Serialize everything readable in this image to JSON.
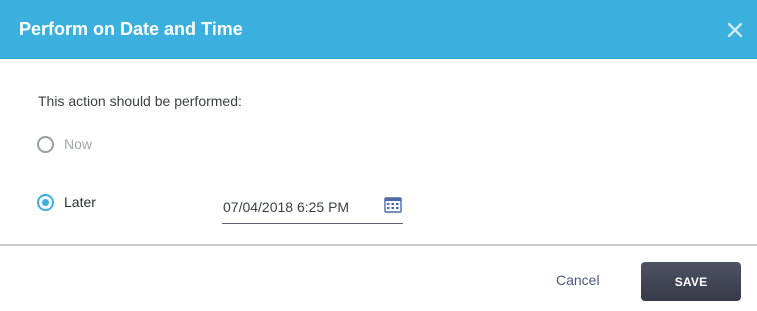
{
  "dialog": {
    "title": "Perform on Date and Time",
    "close_icon": "close-icon"
  },
  "form": {
    "prompt": "This action should be performed:",
    "options": [
      {
        "label": "Now",
        "selected": false,
        "enabled": false
      },
      {
        "label": "Later",
        "selected": true,
        "enabled": true
      }
    ],
    "datetime_value": "07/04/2018 6:25 PM",
    "calendar_icon": "calendar-icon"
  },
  "footer": {
    "cancel_label": "Cancel",
    "save_label": "SAVE"
  },
  "colors": {
    "header_bg": "#3bb0df",
    "radio_selected": "#3bb0df",
    "save_button_bg": "#3f4254",
    "cancel_text": "#4a5a86"
  }
}
